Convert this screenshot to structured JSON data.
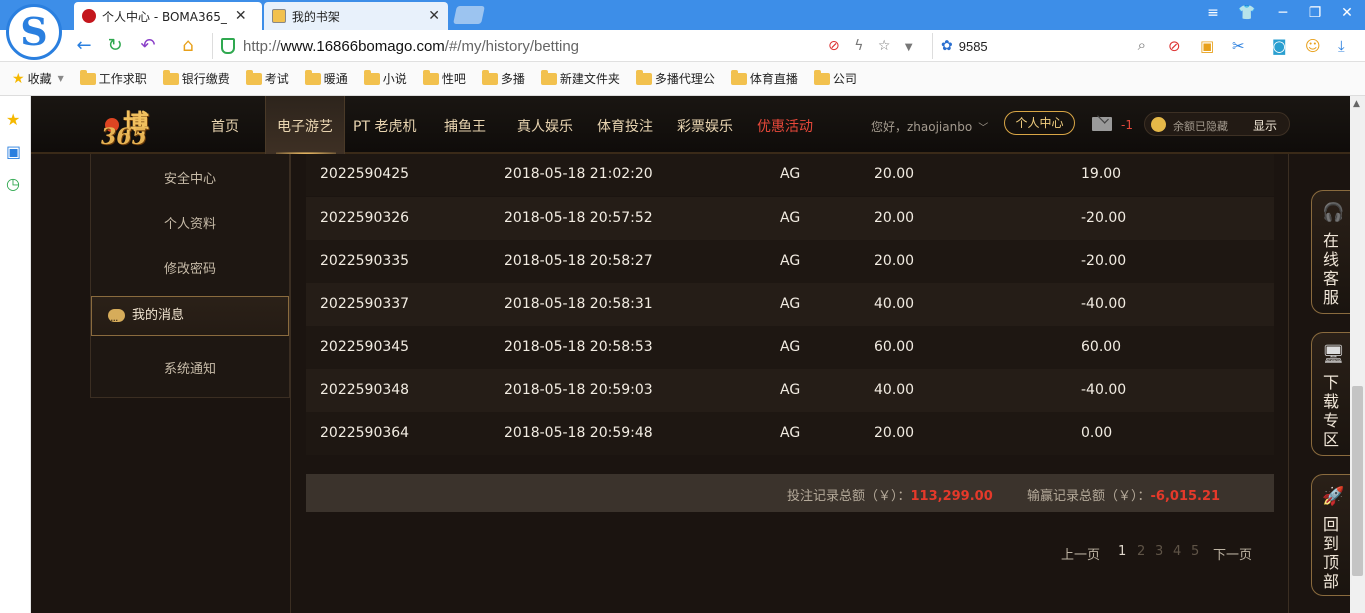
{
  "browser": {
    "tabs": [
      {
        "title": "个人中心 - BOMA365_",
        "active": true
      },
      {
        "title": "我的书架",
        "active": false
      }
    ],
    "url_prefix": "http://",
    "url_host": "www.16866bomago.com",
    "url_path": "/#/my/history/betting",
    "search_value": "9585",
    "bookmarks": [
      {
        "label": "收藏",
        "type": "star"
      },
      {
        "label": "工作求职",
        "type": "folder"
      },
      {
        "label": "银行缴费",
        "type": "folder"
      },
      {
        "label": "考试",
        "type": "folder"
      },
      {
        "label": "暖通",
        "type": "folder"
      },
      {
        "label": "小说",
        "type": "folder"
      },
      {
        "label": "性吧",
        "type": "folder"
      },
      {
        "label": "多播",
        "type": "folder"
      },
      {
        "label": "新建文件夹",
        "type": "folder"
      },
      {
        "label": "多播代理公",
        "type": "folder"
      },
      {
        "label": "体育直播",
        "type": "folder"
      },
      {
        "label": "公司",
        "type": "folder"
      }
    ]
  },
  "site": {
    "nav": [
      "首页",
      "电子游艺",
      "PT 老虎机",
      "捕鱼王",
      "真人娱乐",
      "体育投注",
      "彩票娱乐",
      "优惠活动"
    ],
    "greeting": "您好，zhaojianbo",
    "user_center": "个人中心",
    "mail_count": "-1",
    "balance_hidden": "余额已隐藏",
    "show_label": "显示",
    "menu": [
      "安全中心",
      "个人资料",
      "修改密码",
      "我的消息",
      "系统通知"
    ],
    "records": [
      {
        "id": "2022590425",
        "time": "2018-05-18 21:02:20",
        "platform": "AG",
        "bet": "20.00",
        "winloss": "19.00"
      },
      {
        "id": "2022590326",
        "time": "2018-05-18 20:57:52",
        "platform": "AG",
        "bet": "20.00",
        "winloss": "-20.00"
      },
      {
        "id": "2022590335",
        "time": "2018-05-18 20:58:27",
        "platform": "AG",
        "bet": "20.00",
        "winloss": "-20.00"
      },
      {
        "id": "2022590337",
        "time": "2018-05-18 20:58:31",
        "platform": "AG",
        "bet": "40.00",
        "winloss": "-40.00"
      },
      {
        "id": "2022590345",
        "time": "2018-05-18 20:58:53",
        "platform": "AG",
        "bet": "60.00",
        "winloss": "60.00"
      },
      {
        "id": "2022590348",
        "time": "2018-05-18 20:59:03",
        "platform": "AG",
        "bet": "40.00",
        "winloss": "-40.00"
      },
      {
        "id": "2022590364",
        "time": "2018-05-18 20:59:48",
        "platform": "AG",
        "bet": "20.00",
        "winloss": "0.00"
      }
    ],
    "summary": {
      "bet_label": "投注记录总额（￥）：",
      "bet_total": "113,299.00",
      "win_label": "输赢记录总额（￥）：",
      "win_total": "-6,015.21"
    },
    "pager": {
      "prev": "上一页",
      "pages": [
        "1",
        "2",
        "3",
        "4",
        "5"
      ],
      "next": "下一页"
    },
    "float": [
      {
        "label": "在线客服",
        "icon": "headset-icon"
      },
      {
        "label": "下载专区",
        "icon": "monitor-icon"
      },
      {
        "label": "回到顶部",
        "icon": "rocket-icon"
      }
    ]
  },
  "colors": {
    "accent": "#d9a646",
    "negative": "#e5392a",
    "bg": "#1b1410"
  }
}
